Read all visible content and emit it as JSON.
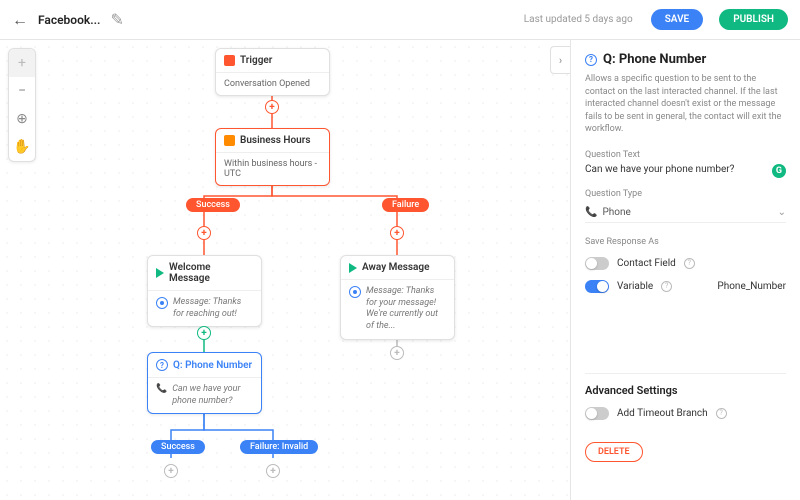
{
  "topbar": {
    "title": "Facebook...",
    "updated": "Last updated 5 days ago",
    "save": "SAVE",
    "publish": "PUBLISH"
  },
  "nodes": {
    "trigger": {
      "title": "Trigger",
      "body": "Conversation Opened"
    },
    "hours": {
      "title": "Business Hours",
      "body": "Within business hours - UTC"
    },
    "welcome": {
      "title": "Welcome Message",
      "msgLabel": "Message:",
      "msg": "Thanks for reaching out!"
    },
    "away": {
      "title": "Away Message",
      "msgLabel": "Message:",
      "msg": "Thanks for your message! We're currently out of the..."
    },
    "question": {
      "title": "Q: Phone Number",
      "msg": "Can we have your phone number?"
    }
  },
  "pills": {
    "success": "Success",
    "failure": "Failure",
    "qSuccess": "Success",
    "qFailure": "Failure: Invalid"
  },
  "panel": {
    "title": "Q: Phone Number",
    "desc": "Allows a specific question to be sent to the contact on the last interacted channel. If the last interacted channel doesn't exist or the message fails to be sent in general, the contact will exit the workflow.",
    "qTextLabel": "Question Text",
    "qText": "Can we have your phone number?",
    "qTypeLabel": "Question Type",
    "qType": "Phone",
    "saveAsLabel": "Save Response As",
    "contactField": "Contact Field",
    "variable": "Variable",
    "variableValue": "Phone_Number",
    "advanced": "Advanced Settings",
    "timeout": "Add Timeout Branch",
    "delete": "DELETE"
  }
}
